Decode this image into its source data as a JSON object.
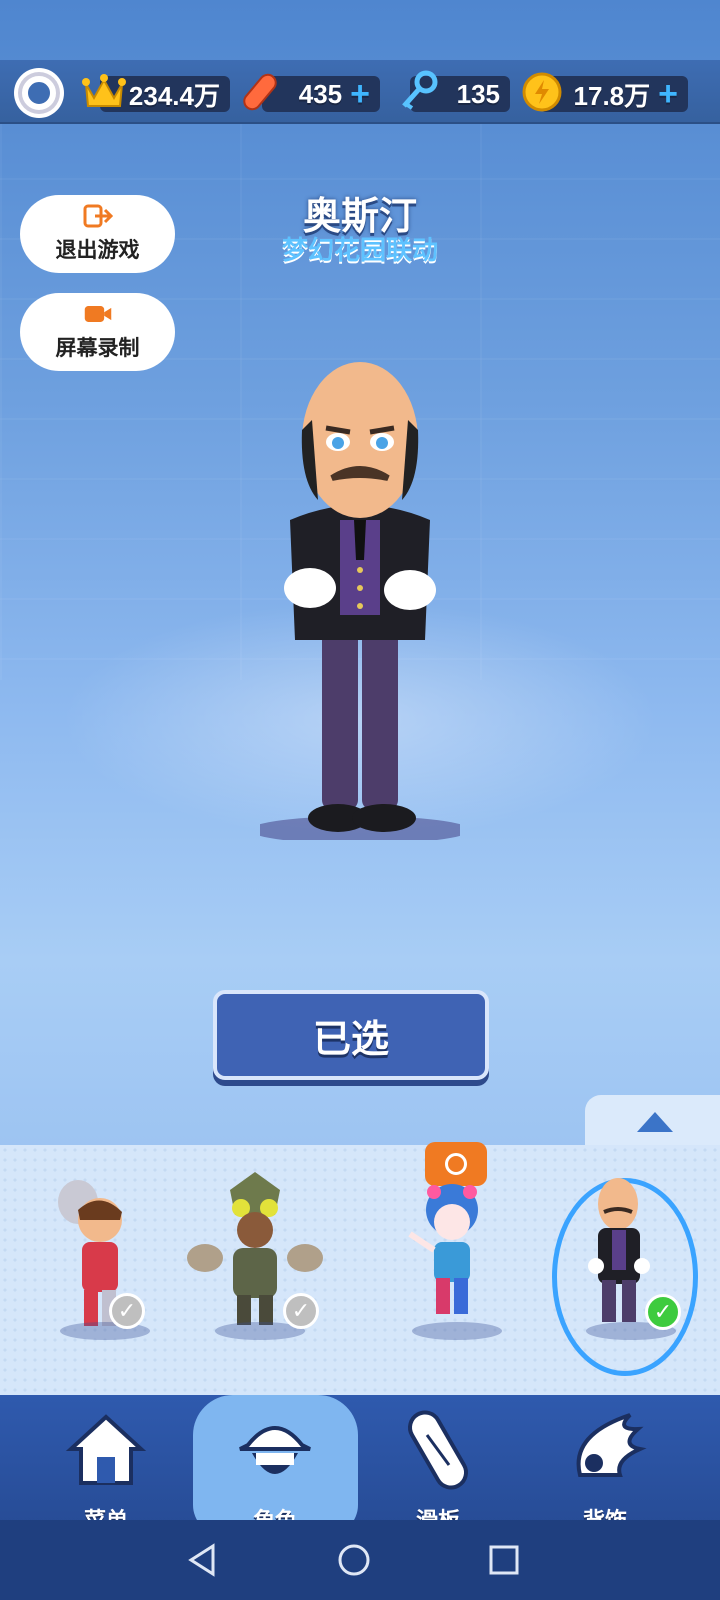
{
  "top_bar": {
    "crowns": "234.4万",
    "boards": "435",
    "keys": "135",
    "coins": "17.8万",
    "plus": "+"
  },
  "character": {
    "name": "奥斯汀",
    "event": "梦幻花园联动"
  },
  "side_buttons": {
    "exit_label": "退出游戏",
    "record_label": "屏幕录制"
  },
  "select_button": "已选",
  "carousel": {
    "items": [
      {
        "name": "hero-1",
        "owned": true
      },
      {
        "name": "hero-2",
        "owned": true
      },
      {
        "name": "hero-3",
        "limited": true
      },
      {
        "name": "austin",
        "owned": true,
        "selected": true
      }
    ]
  },
  "nav": {
    "menu": "菜单",
    "characters": "角色",
    "boards": "滑板",
    "backpacks": "背饰"
  },
  "colors": {
    "accent": "#3aa3ff",
    "button": "#3f63b4",
    "timer": "#f07a22",
    "check_on": "#3ecb3e"
  }
}
